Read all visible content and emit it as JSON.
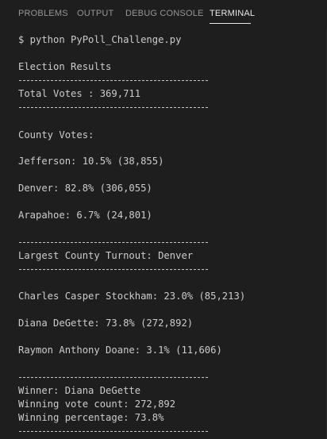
{
  "panel": {
    "tabs": [
      {
        "label": "PROBLEMS",
        "active": false
      },
      {
        "label": "OUTPUT",
        "active": false
      },
      {
        "label": "DEBUG CONSOLE",
        "active": false
      },
      {
        "label": "TERMINAL",
        "active": true
      }
    ]
  },
  "terminal": {
    "command": "$ python PyPoll_Challenge.py",
    "election_results": "Election Results",
    "total_votes": "Total Votes : 369,711",
    "county_votes_header": "County Votes:",
    "counties": [
      "Jefferson: 10.5% (38,855)",
      "Denver: 82.8% (306,055)",
      "Arapahoe: 6.7% (24,801)"
    ],
    "largest_county": "Largest County Turnout: Denver",
    "candidates": [
      "Charles Casper Stockham: 23.0% (85,213)",
      "Diana DeGette: 73.8% (272,892)",
      "Raymon Anthony Doane: 3.1% (11,606)"
    ],
    "winner": "Winner: Diana DeGette",
    "winning_vote_count": "Winning vote count: 272,892",
    "winning_percentage": "Winning percentage: 73.8%"
  }
}
